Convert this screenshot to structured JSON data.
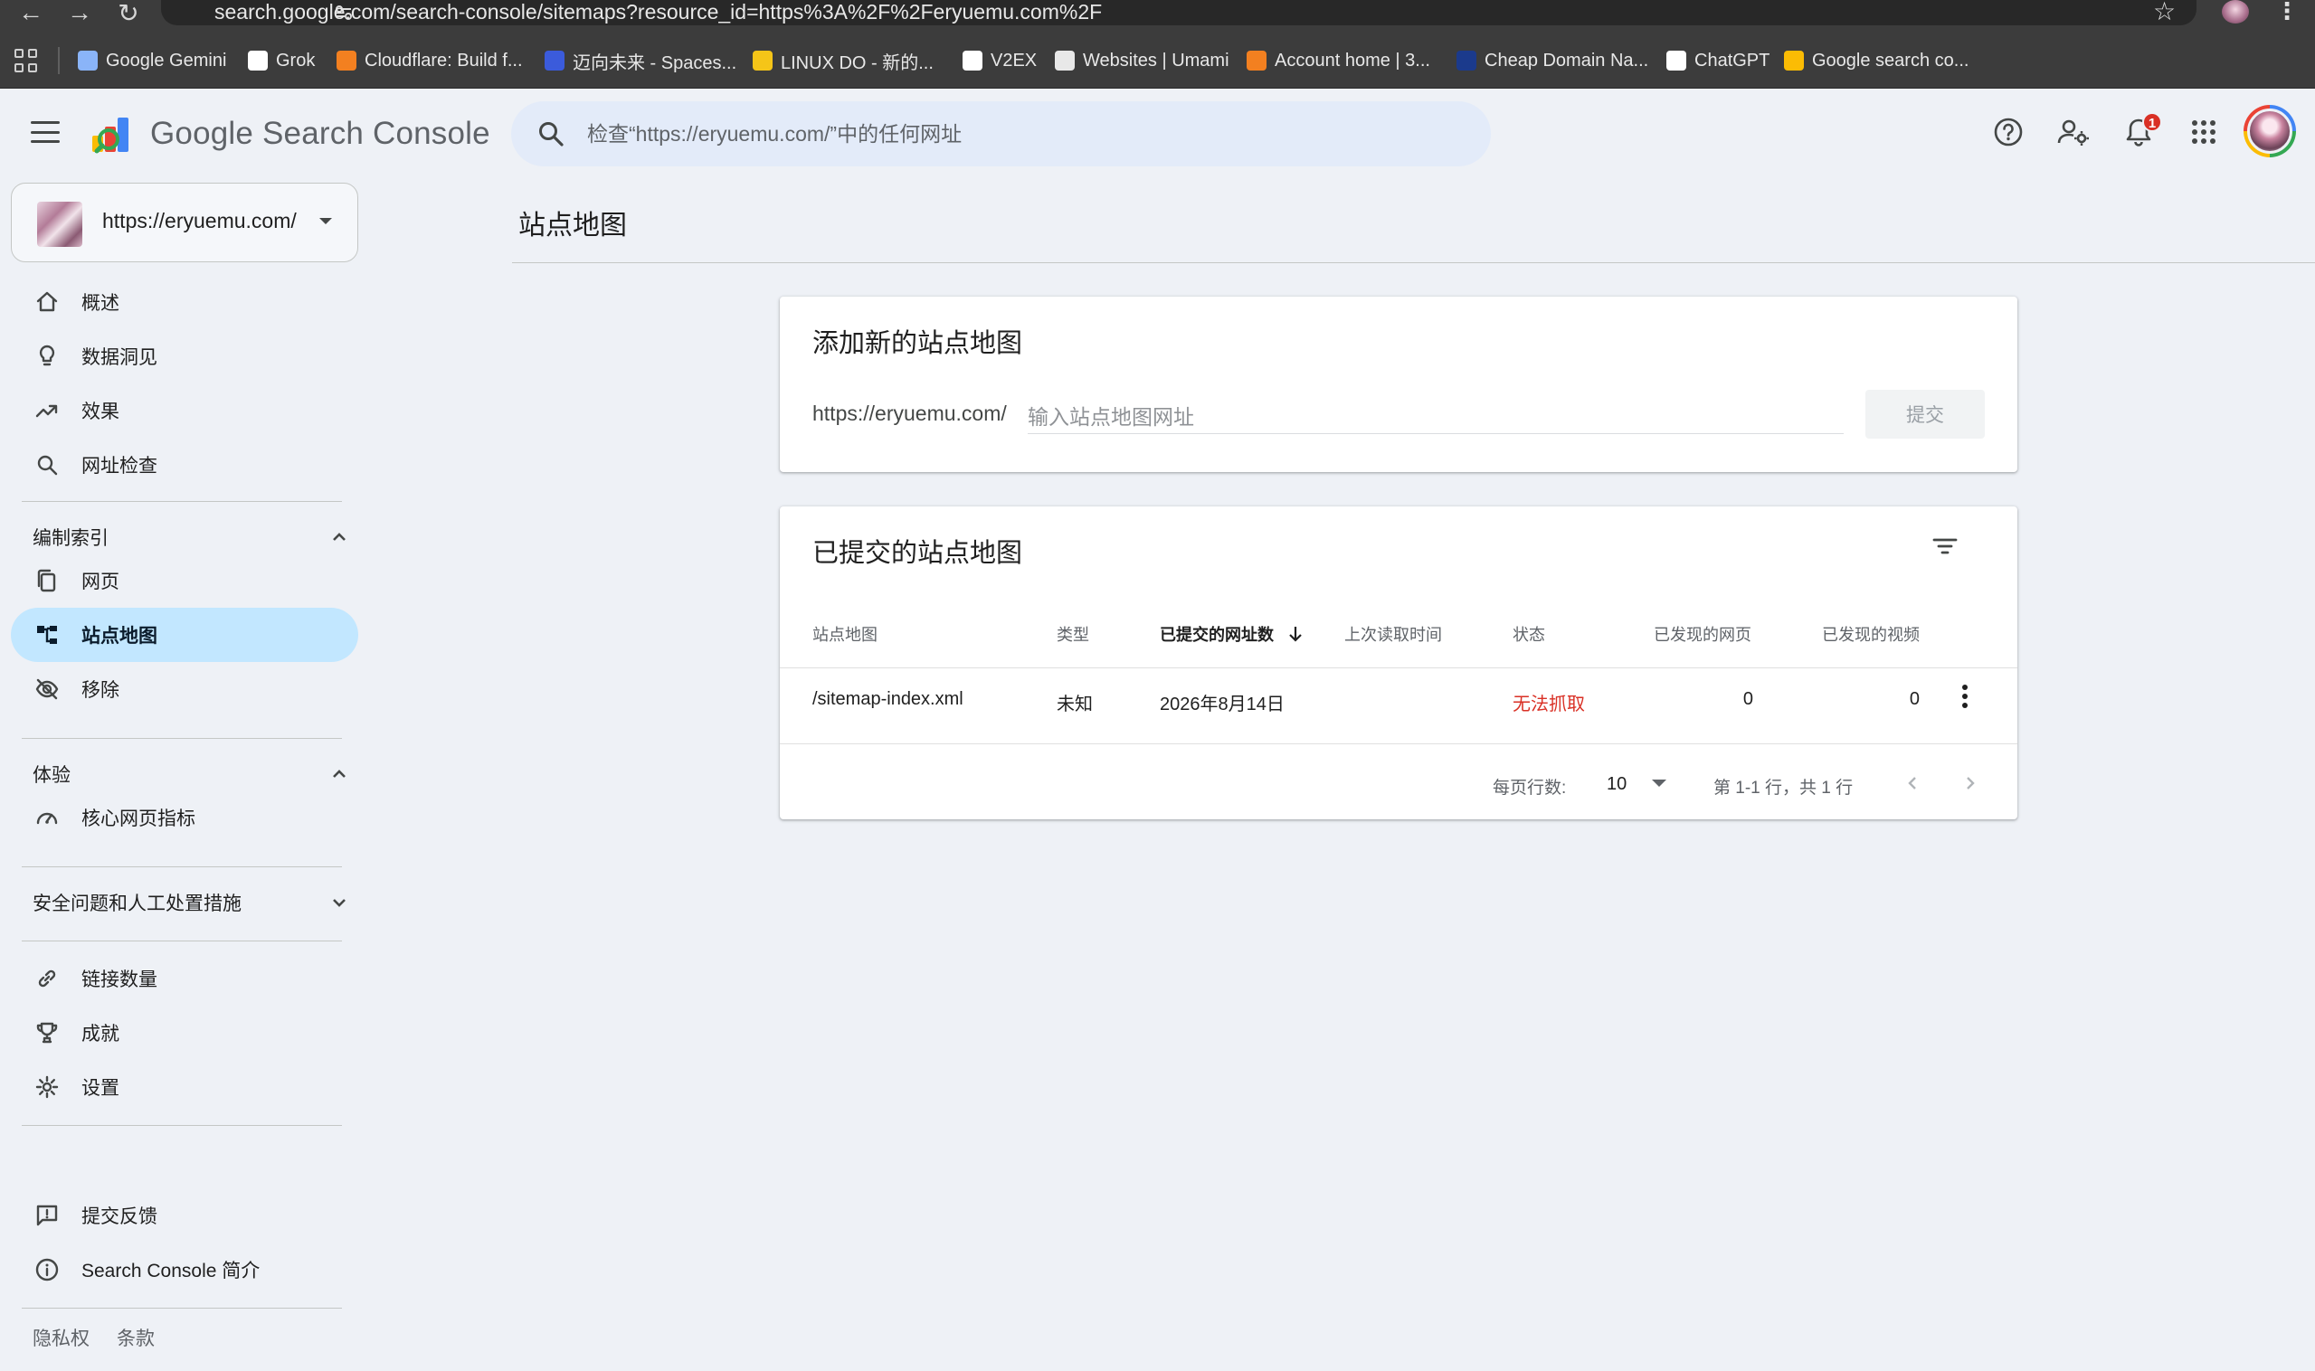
{
  "browser": {
    "url": "search.google.com/search-console/sitemaps?resource_id=https%3A%2F%2Feryuemu.com%2F",
    "bookmarks": [
      {
        "label": "Google Gemini",
        "icon": "gemini-icon",
        "color": "#8ab4f8"
      },
      {
        "label": "Grok",
        "icon": "grok-icon",
        "color": "#ffffff"
      },
      {
        "label": "Cloudflare: Build f...",
        "icon": "cloudflare-icon",
        "color": "#f38020"
      },
      {
        "label": "迈向未来 - Spaces...",
        "icon": "spaces-icon",
        "color": "#3b5bdb"
      },
      {
        "label": "LINUX DO - 新的...",
        "icon": "linuxdo-icon",
        "color": "#f5c518"
      },
      {
        "label": "V2EX",
        "icon": "v2ex-icon",
        "color": "#ffffff"
      },
      {
        "label": "Websites | Umami",
        "icon": "umami-icon",
        "color": "#e8e8e8"
      },
      {
        "label": "Account home | 3...",
        "icon": "cloud-icon",
        "color": "#f38020"
      },
      {
        "label": "Cheap Domain Na...",
        "icon": "namecheap-icon",
        "color": "#1b3a8c"
      },
      {
        "label": "ChatGPT",
        "icon": "chatgpt-icon",
        "color": "#ffffff"
      },
      {
        "label": "Google search co...",
        "icon": "search-console-icon",
        "color": "#fbbc04"
      }
    ]
  },
  "header": {
    "app_name": "Google Search Console",
    "search_placeholder": "检查“https://eryuemu.com/”中的任何网址",
    "notification_count": "1"
  },
  "sidebar": {
    "property": "https://eryuemu.com/",
    "top_items": [
      {
        "label": "概述",
        "icon": "home-icon"
      },
      {
        "label": "数据洞见",
        "icon": "lightbulb-icon"
      },
      {
        "label": "效果",
        "icon": "trending-up-icon"
      },
      {
        "label": "网址检查",
        "icon": "search-icon"
      }
    ],
    "section_index": {
      "label": "编制索引"
    },
    "index_items": [
      {
        "label": "网页",
        "icon": "pages-icon"
      },
      {
        "label": "站点地图",
        "icon": "sitemap-icon"
      },
      {
        "label": "移除",
        "icon": "visibility-off-icon"
      }
    ],
    "section_experience": {
      "label": "体验"
    },
    "experience_items": [
      {
        "label": "核心网页指标",
        "icon": "speed-icon"
      }
    ],
    "section_security": {
      "label": "安全问题和人工处置措施"
    },
    "other_items": [
      {
        "label": "链接数量",
        "icon": "link-icon"
      },
      {
        "label": "成就",
        "icon": "trophy-icon"
      },
      {
        "label": "设置",
        "icon": "settings-icon"
      }
    ],
    "bottom_items": [
      {
        "label": "提交反馈",
        "icon": "feedback-icon"
      },
      {
        "label": "Search Console 简介",
        "icon": "info-icon"
      }
    ],
    "footer": {
      "privacy": "隐私权",
      "terms": "条款"
    }
  },
  "main": {
    "title": "站点地图",
    "add_card": {
      "title": "添加新的站点地图",
      "prefix": "https://eryuemu.com/",
      "placeholder": "输入站点地图网址",
      "submit": "提交"
    },
    "submitted_card": {
      "title": "已提交的站点地图",
      "columns": [
        "站点地图",
        "类型",
        "已提交的网址数",
        "上次读取时间",
        "状态",
        "已发现的网页",
        "已发现的视频"
      ],
      "rows": [
        {
          "sitemap": "/sitemap-index.xml",
          "type": "未知",
          "submitted": "2026年8月14日",
          "last_read": "",
          "status": "无法抓取",
          "pages": "0",
          "videos": "0"
        }
      ],
      "pagination": {
        "rows_per_page_label": "每页行数:",
        "rows_per_page": "10",
        "range": "第 1-1 行，共 1 行"
      }
    }
  },
  "colors": {
    "accent": "#c2e7ff",
    "error": "#d93025",
    "background": "#eef1f6"
  }
}
